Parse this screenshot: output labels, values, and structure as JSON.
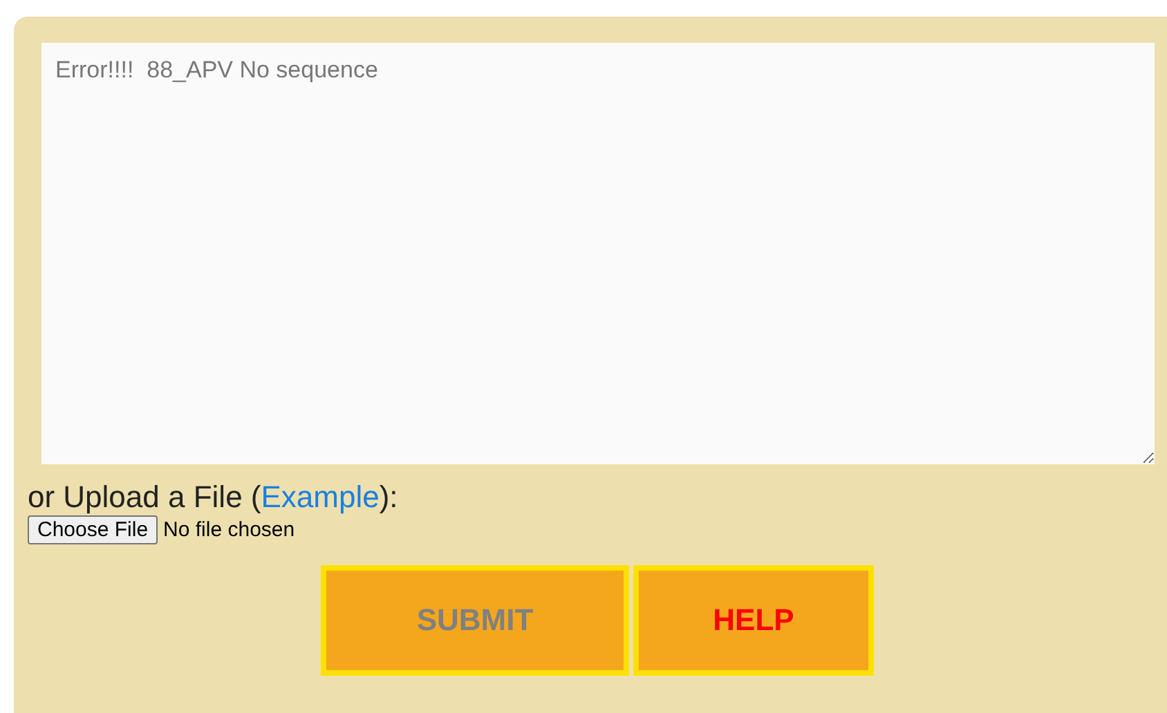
{
  "sequence_field": {
    "placeholder": "Error!!!!  88_APV No sequence"
  },
  "upload": {
    "label_before": "or Upload a File (",
    "link": "Example",
    "label_after": "):",
    "choose_button": "Choose File",
    "file_status": "No file chosen"
  },
  "buttons": [
    {
      "label": "SUBMIT",
      "kind": "submit"
    },
    {
      "label": "HELP",
      "kind": "help"
    }
  ]
}
